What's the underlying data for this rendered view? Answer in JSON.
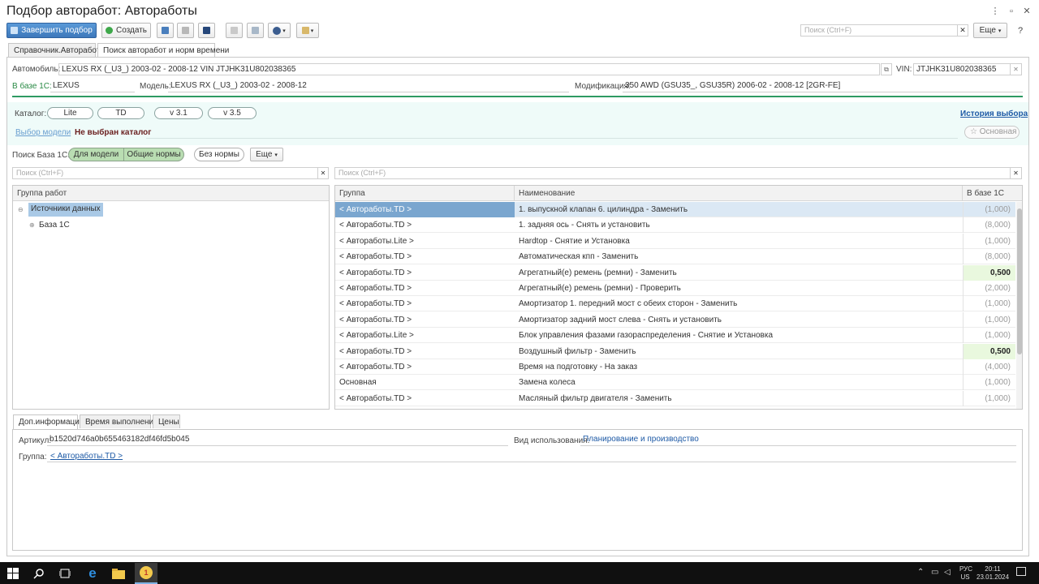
{
  "window": {
    "title": "Подбор авторабот: Автоработы"
  },
  "toolbar": {
    "finish_label": "Завершить подбор",
    "create_label": "Создать",
    "search_placeholder": "Поиск (Ctrl+F)",
    "more_label": "Еще"
  },
  "tabs": [
    {
      "label": "Справочник.Автоработы"
    },
    {
      "label": "Поиск авторабот и норм времени"
    }
  ],
  "car": {
    "label": "Автомобиль:",
    "value": "LEXUS RX (_U3_) 2003-02 - 2008-12 VIN JTJHK31U802038365",
    "vin_label": "VIN:",
    "vin_value": "JTJHK31U802038365"
  },
  "base": {
    "label": "В базе 1С:",
    "value": "LEXUS",
    "model_label": "Модель:",
    "model_value": "LEXUS RX (_U3_) 2003-02 - 2008-12",
    "mod_label": "Модификация:",
    "mod_value": "350 AWD (GSU35_, GSU35R) 2006-02 - 2008-12 [2GR-FE]"
  },
  "catalog": {
    "label": "Каталог:",
    "buttons": [
      "Lite",
      "TD",
      "v 3.1",
      "v 3.5"
    ],
    "history_link": "История выбора",
    "model_link": "Выбор модели",
    "not_selected": "Не выбран каталог",
    "main_label": "Основная"
  },
  "filter": {
    "label": "Поиск База 1С:",
    "for_model": "Для модели",
    "general": "Общие нормы",
    "no_norm": "Без нормы",
    "more": "Еще"
  },
  "left_search": {
    "placeholder": "Поиск (Ctrl+F)"
  },
  "right_search": {
    "placeholder": "Поиск (Ctrl+F)"
  },
  "tree": {
    "header": "Группа работ",
    "items": [
      {
        "label": "Источники данных"
      },
      {
        "label": "База 1С"
      }
    ]
  },
  "table": {
    "headers": [
      "Группа",
      "Наименование",
      "В базе 1С"
    ],
    "rows": [
      {
        "group": "< Автоработы.TD >",
        "name": "1. выпускной клапан 6. цилиндра - Заменить",
        "value": "(1,000)",
        "highlight": false
      },
      {
        "group": "< Автоработы.TD >",
        "name": "1. задняя ось - Снять и установить",
        "value": "(8,000)",
        "highlight": false
      },
      {
        "group": "< Автоработы.Lite >",
        "name": "Hardtop - Снятие и Установка",
        "value": "(1,000)",
        "highlight": false
      },
      {
        "group": "< Автоработы.TD >",
        "name": "Автоматическая кпп - Заменить",
        "value": "(8,000)",
        "highlight": false
      },
      {
        "group": "< Автоработы.TD >",
        "name": "Агрегатный(е) ремень (ремни) - Заменить",
        "value": "0,500",
        "highlight": true
      },
      {
        "group": "< Автоработы.TD >",
        "name": "Агрегатный(е) ремень (ремни) - Проверить",
        "value": "(2,000)",
        "highlight": false
      },
      {
        "group": "< Автоработы.TD >",
        "name": "Амортизатор 1. передний мост с обеих сторон - Заменить",
        "value": "(1,000)",
        "highlight": false
      },
      {
        "group": "< Автоработы.TD >",
        "name": "Амортизатор задний мост слева - Снять и установить",
        "value": "(1,000)",
        "highlight": false
      },
      {
        "group": "< Автоработы.Lite >",
        "name": "Блок управления фазами газораспределения - Снятие и Установка",
        "value": "(1,000)",
        "highlight": false
      },
      {
        "group": "< Автоработы.TD >",
        "name": "Воздушный фильтр - Заменить",
        "value": "0,500",
        "highlight": true
      },
      {
        "group": "< Автоработы.TD >",
        "name": "Время на подготовку - На заказ",
        "value": "(4,000)",
        "highlight": false
      },
      {
        "group": "Основная",
        "name": "Замена колеса",
        "value": "(1,000)",
        "highlight": false
      },
      {
        "group": "< Автоработы.TD >",
        "name": "Масляный фильтр двигателя - Заменить",
        "value": "(1,000)",
        "highlight": false
      }
    ]
  },
  "bottom_tabs": [
    {
      "label": "Доп.информация"
    },
    {
      "label": "Время выполнения"
    },
    {
      "label": "Цены"
    }
  ],
  "details": {
    "article_label": "Артикул:",
    "article_value": "b1520d746a0b655463182df46fd5b045",
    "usage_label": "Вид использования:",
    "usage_value": "Планирование и производство",
    "group_label": "Группа:",
    "group_value": "< Автоработы.TD >"
  },
  "taskbar": {
    "lang": "РУС",
    "layout": "US",
    "time": "20:11",
    "date": "23.01.2024"
  },
  "colors": {
    "accent": "#3d78bb",
    "selected_row": "#a9c9e6",
    "highlight_value": "#e9f8de",
    "catalog_panel": "#effbf9",
    "divider_green": "#2e9b63"
  }
}
